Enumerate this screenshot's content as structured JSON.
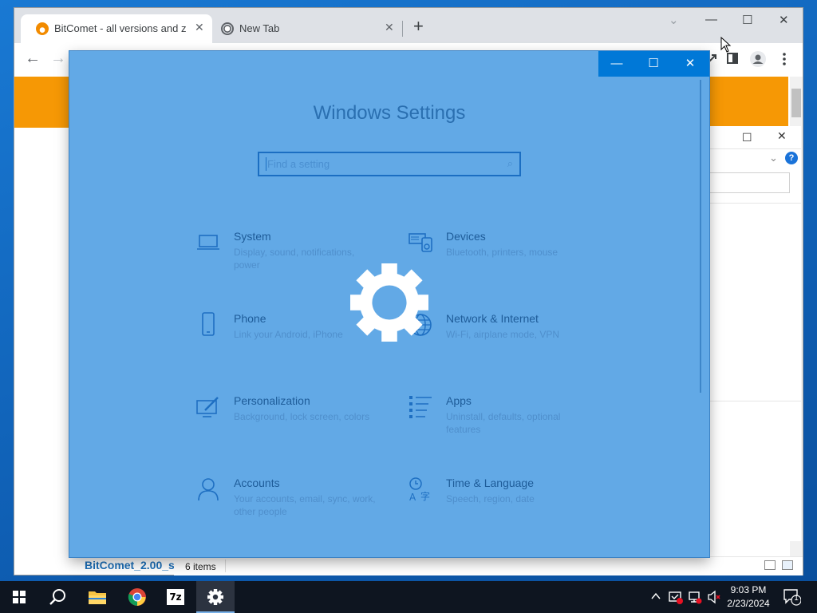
{
  "browser": {
    "tabs": [
      {
        "title": "BitComet - all versions and zip p",
        "active": true
      },
      {
        "title": "New Tab",
        "active": false
      }
    ],
    "new_tab_label": "+",
    "controls": {
      "dropdown": "⌄",
      "minimize": "—",
      "maximize": "☐",
      "close": "✕"
    },
    "nav": {
      "back": "←",
      "forward": "→"
    }
  },
  "page": {
    "bitcomet_text": "BitComet_2.00_s",
    "accent_color": "#f69805"
  },
  "explorer": {
    "item_count": "6 items"
  },
  "settings": {
    "title": "Windows Settings",
    "search_placeholder": "Find a setting",
    "controls": {
      "minimize": "—",
      "maximize": "☐",
      "close": "✕"
    },
    "categories": [
      {
        "name": "System",
        "desc": "Display, sound, notifications, power",
        "icon": "laptop-icon"
      },
      {
        "name": "Devices",
        "desc": "Bluetooth, printers, mouse",
        "icon": "devices-icon"
      },
      {
        "name": "Phone",
        "desc": "Link your Android, iPhone",
        "icon": "phone-icon"
      },
      {
        "name": "Network & Internet",
        "desc": "Wi-Fi, airplane mode, VPN",
        "icon": "globe-icon"
      },
      {
        "name": "Personalization",
        "desc": "Background, lock screen, colors",
        "icon": "paintbrush-icon"
      },
      {
        "name": "Apps",
        "desc": "Uninstall, defaults, optional features",
        "icon": "apps-list-icon"
      },
      {
        "name": "Accounts",
        "desc": "Your accounts, email, sync, work, other people",
        "icon": "person-icon"
      },
      {
        "name": "Time & Language",
        "desc": "Speech, region, date",
        "icon": "time-language-icon"
      }
    ],
    "colors": {
      "background": "#62a9e6",
      "titlebar": "#0078d7"
    }
  },
  "taskbar": {
    "apps": [
      "start-icon",
      "search-icon",
      "file-explorer-icon",
      "chrome-icon",
      "7zip-icon",
      "settings-icon"
    ],
    "sevenzip_label": "7z",
    "time": "9:03 PM",
    "date": "2/23/2024",
    "notification_count": "1"
  }
}
